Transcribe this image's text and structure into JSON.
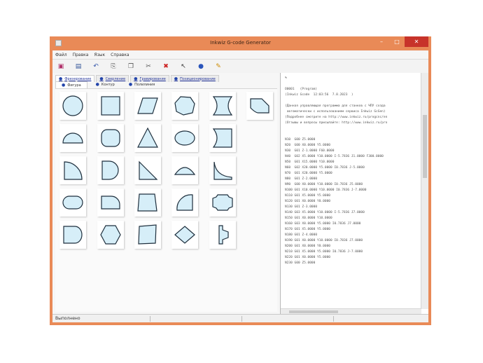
{
  "window": {
    "title": "Inkwiz G-code Generator"
  },
  "menu": [
    "Файл",
    "Правка",
    "Язык",
    "Справка"
  ],
  "toolbar": [
    {
      "name": "save",
      "glyph": "▣"
    },
    {
      "name": "preview",
      "glyph": "▤"
    },
    {
      "name": "undo",
      "glyph": "↶"
    },
    {
      "name": "copy",
      "glyph": "⎘"
    },
    {
      "name": "paste",
      "glyph": "❐"
    },
    {
      "name": "cut",
      "glyph": "✂"
    },
    {
      "name": "delete",
      "glyph": "✖"
    },
    {
      "name": "pointer",
      "glyph": "↖"
    },
    {
      "name": "refresh",
      "glyph": "●"
    },
    {
      "name": "tools",
      "glyph": "✎"
    }
  ],
  "tabs": [
    "Фрезерование",
    "Сверление",
    "Гравирование",
    "Позиционирование"
  ],
  "subtabs": [
    "Фигура",
    "Контур",
    "Полилиния"
  ],
  "shapes": [
    {
      "name": "circle"
    },
    {
      "name": "rectangle"
    },
    {
      "name": "parallelogram"
    },
    {
      "name": "octagon"
    },
    {
      "name": "concave-sides"
    },
    {
      "name": "notched-rectangle"
    },
    {
      "name": "half-circle"
    },
    {
      "name": "rounded-square"
    },
    {
      "name": "triangle"
    },
    {
      "name": "ellipse"
    },
    {
      "name": "concave-left"
    },
    {
      "name": "quarter-circle"
    },
    {
      "name": "d-shape"
    },
    {
      "name": "right-triangle"
    },
    {
      "name": "segment"
    },
    {
      "name": "concave-corner"
    },
    {
      "name": "stadium"
    },
    {
      "name": "quarter-rounded-rect"
    },
    {
      "name": "trapezoid"
    },
    {
      "name": "arc-corner"
    },
    {
      "name": "notched-oval"
    },
    {
      "name": "d-rect"
    },
    {
      "name": "hexagon"
    },
    {
      "name": "skewed-rect"
    },
    {
      "name": "diamond"
    },
    {
      "name": "bracket"
    }
  ],
  "code_lines": [
    "%",
    "",
    "O0001   (Program)",
    "(Inkwiz Gcode  12:03:56  7.8.2023  )",
    "",
    "(Данная управляющая программа для станков с ЧПУ созда",
    " автоматически с использованием сервиса Inkwiz GcGen)",
    "(Подробнее смотрите на http://www.inkwiz.ru/progcnc/en",
    "(Отзывы и вопросы присылайте: http://www.inkwiz.ru/pro",
    "",
    "",
    "N10  G00 Z5.0000",
    "N20  G00 X0.0000 Y5.0000",
    "N30  G01 Z-1.0000 F60.0000",
    "N40  G02 X5.0000 Y10.0000 I-5.7836 J1.0000 F300.0000",
    "N50  G01 X15.0000 Y10.0000",
    "N60  G02 X20.0000 Y5.0000 I0.7836 J-5.0000",
    "N70  G01 X20.0000 Y5.0000",
    "N80  G01 Z-2.0000",
    "N90  G00 X0.0000 Y10.0000 I0.7836 J5.0000",
    "N100 G01 X10.0000 Y10.0000 I0.7836 J-7.0000",
    "N110 G01 X5.0000 Y5.0000",
    "N120 G01 X0.0000 Y0.0000",
    "N130 G01 Z-3.0000",
    "N140 G03 X5.0000 Y10.0000 I-5.7836 J7.0000",
    "N150 G01 X0.0000 Y10.0000",
    "N160 G03 X0.0000 Y5.0000 I0.7836 J7.0000",
    "N170 G01 X5.0000 Y5.0000",
    "N180 G01 Z-4.0000",
    "N190 G01 X0.0000 Y10.0000 I0.7836 J7.0000",
    "N200 G01 X0.0000 Y0.0000",
    "N210 G01 X5.0000 Y5.0000 I0.7836 J-7.0000",
    "N220 G01 X0.0000 Y5.0000",
    "N230 G00 Z5.0000"
  ],
  "status": {
    "text": "Выполнено"
  }
}
